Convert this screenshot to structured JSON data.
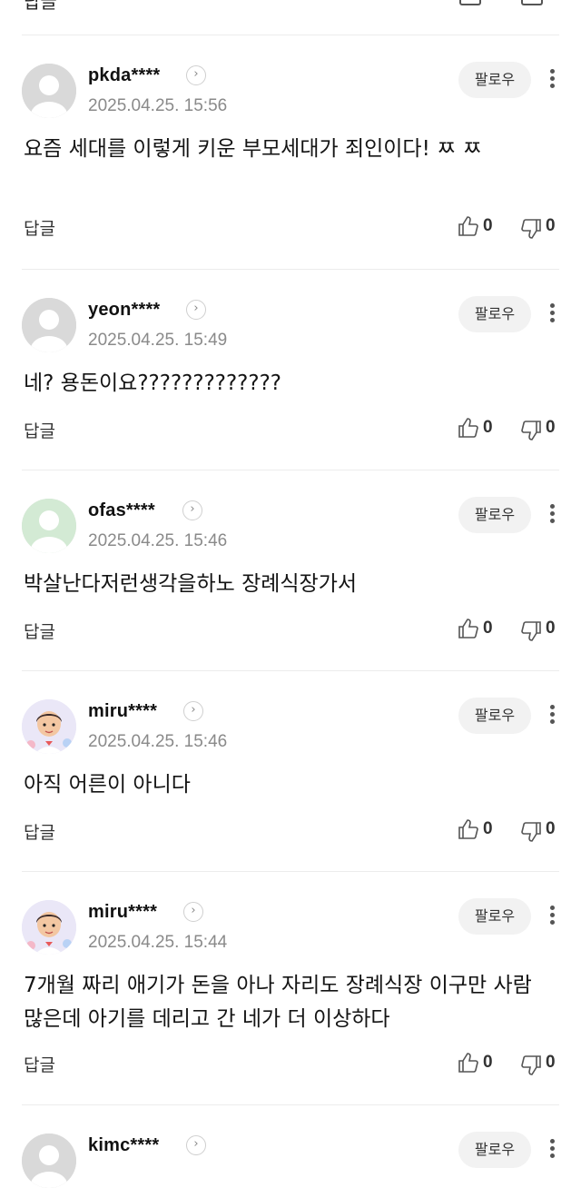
{
  "top": {
    "reply_label": "답글"
  },
  "comments": [
    {
      "username": "pkda****",
      "timestamp": "2025.04.25. 15:56",
      "follow_label": "팔로우",
      "text": "요즘 세대를 이렇게 키운 부모세대가 죄인이다! ㅉ ㅉ",
      "reply_label": "답글",
      "likes": "0",
      "dislikes": "0",
      "avatar": "default-gray"
    },
    {
      "username": "yeon****",
      "timestamp": "2025.04.25. 15:49",
      "follow_label": "팔로우",
      "text": "네? 용돈이요?????????????",
      "reply_label": "답글",
      "likes": "0",
      "dislikes": "0",
      "avatar": "default-gray"
    },
    {
      "username": "ofas****",
      "timestamp": "2025.04.25. 15:46",
      "follow_label": "팔로우",
      "text": "박살난다저런생각을하노 장례식장가서",
      "reply_label": "답글",
      "likes": "0",
      "dislikes": "0",
      "avatar": "default-green"
    },
    {
      "username": "miru****",
      "timestamp": "2025.04.25. 15:46",
      "follow_label": "팔로우",
      "text": "아직 어른이 아니다",
      "reply_label": "답글",
      "likes": "0",
      "dislikes": "0",
      "avatar": "cartoon-boy"
    },
    {
      "username": "miru****",
      "timestamp": "2025.04.25. 15:44",
      "follow_label": "팔로우",
      "text": "7개월 짜리 애기가 돈을 아나 자리도 장례식장 이구만 사람 많은데 아기를 데리고 간 네가 더 이상하다",
      "reply_label": "답글",
      "likes": "0",
      "dislikes": "0",
      "avatar": "cartoon-boy"
    },
    {
      "username": "kimc****",
      "timestamp": "",
      "follow_label": "팔로우",
      "text": "",
      "avatar": "default-gray"
    }
  ],
  "colors": {
    "divider": "#ececec",
    "follow_bg": "#f2f2f2",
    "timestamp": "#8a8a8a"
  }
}
